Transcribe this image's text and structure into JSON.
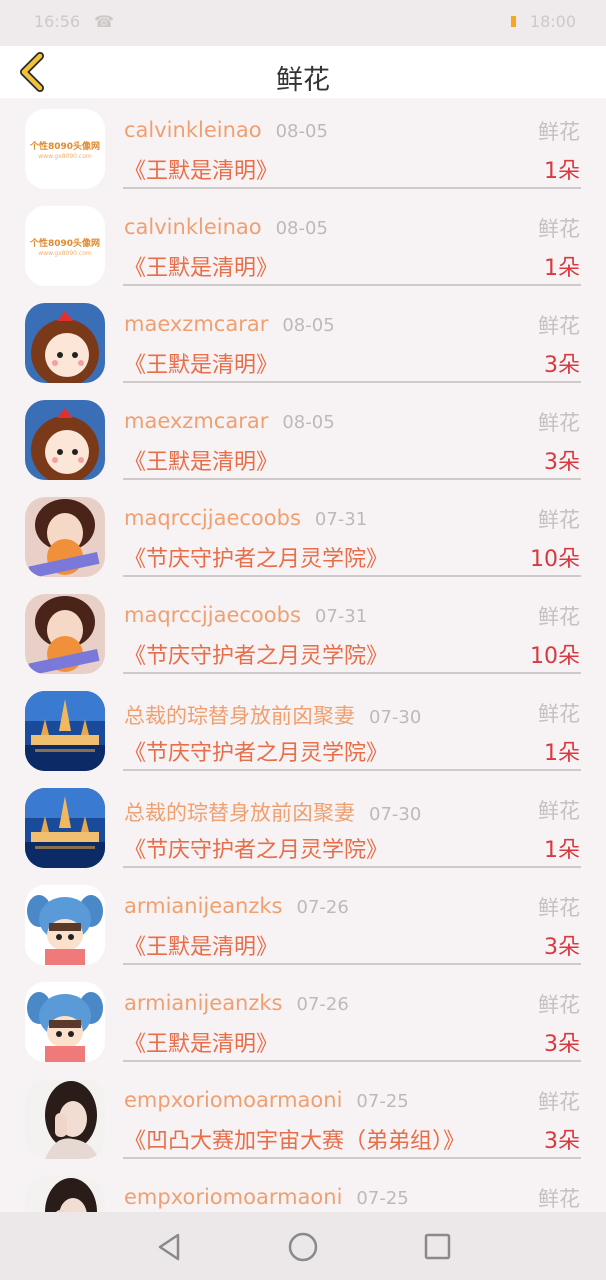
{
  "status": {
    "left": "16:56",
    "right": "18:00"
  },
  "header": {
    "title": "鲜花"
  },
  "rows": [
    {
      "name": "calvinkleinao",
      "date": "08-05",
      "type": "鲜花",
      "book": "《王默是清明》",
      "count": "1朵",
      "avatar": "logo-avatar",
      "logo_text": "个性8090头像网",
      "logo_sub": "www.gx8090.com"
    },
    {
      "name": "calvinkleinao",
      "date": "08-05",
      "type": "鲜花",
      "book": "《王默是清明》",
      "count": "1朵",
      "avatar": "logo-avatar",
      "logo_text": "个性8090头像网",
      "logo_sub": "www.gx8090.com"
    },
    {
      "name": "maexzmcarar",
      "date": "08-05",
      "type": "鲜花",
      "book": "《王默是清明》",
      "count": "3朵",
      "avatar": "cartoon-girl-avatar"
    },
    {
      "name": "maexzmcarar",
      "date": "08-05",
      "type": "鲜花",
      "book": "《王默是清明》",
      "count": "3朵",
      "avatar": "cartoon-girl-avatar"
    },
    {
      "name": "maqrccjjaecoobs",
      "date": "07-31",
      "type": "鲜花",
      "book": "《节庆守护者之月灵学院》",
      "count": "10朵",
      "avatar": "girl-lollipop-avatar"
    },
    {
      "name": "maqrccjjaecoobs",
      "date": "07-31",
      "type": "鲜花",
      "book": "《节庆守护者之月灵学院》",
      "count": "10朵",
      "avatar": "girl-lollipop-avatar"
    },
    {
      "name": "总裁的琮替身放前囟聚妻",
      "date": "07-30",
      "type": "鲜花",
      "book": "《节庆守护者之月灵学院》",
      "count": "1朵",
      "avatar": "temple-night-avatar"
    },
    {
      "name": "总裁的琮替身放前囟聚妻",
      "date": "07-30",
      "type": "鲜花",
      "book": "《节庆守护者之月灵学院》",
      "count": "1朵",
      "avatar": "temple-night-avatar"
    },
    {
      "name": "armianijeanzks",
      "date": "07-26",
      "type": "鲜花",
      "book": "《王默是清明》",
      "count": "3朵",
      "avatar": "stitch-cartoon-avatar"
    },
    {
      "name": "armianijeanzks",
      "date": "07-26",
      "type": "鲜花",
      "book": "《王默是清明》",
      "count": "3朵",
      "avatar": "stitch-cartoon-avatar"
    },
    {
      "name": "empxoriomoarmaoni",
      "date": "07-25",
      "type": "鲜花",
      "book": "《凹凸大赛加宇宙大赛（弟弟组）》",
      "count": "3朵",
      "avatar": "girl-portrait-avatar"
    },
    {
      "name": "empxoriomoarmaoni",
      "date": "07-25",
      "type": "鲜花",
      "book": "",
      "count": "",
      "avatar": "girl-portrait-avatar"
    }
  ],
  "colors": {
    "name": "#f0a070",
    "book": "#e86d49",
    "count": "#d83840",
    "back_arrow": "#f2c23a"
  }
}
